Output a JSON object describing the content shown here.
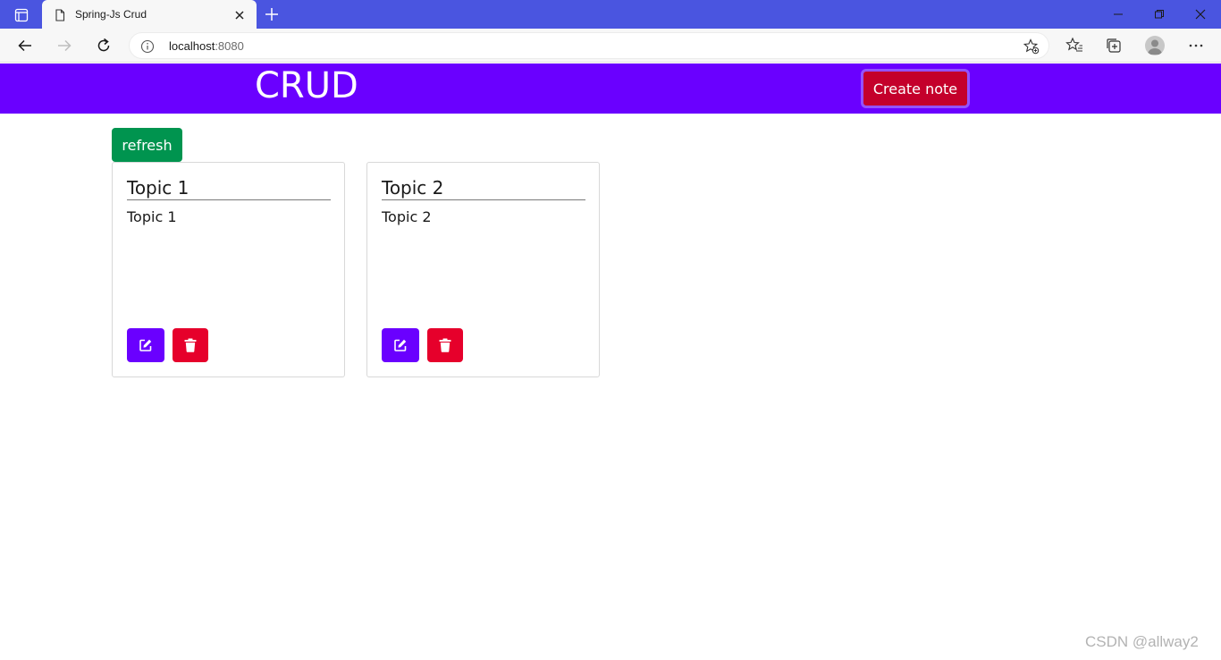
{
  "browser": {
    "tab_title": "Spring-Js Crud",
    "url_host": "localhost",
    "url_port": ":8080"
  },
  "icons": {
    "tab_actions": "tab-actions-icon",
    "favicon": "page-icon",
    "tab_close": "close-icon",
    "new_tab": "plus-icon",
    "minimize": "minimize-icon",
    "restore": "restore-icon",
    "window_close": "close-icon",
    "back": "arrow-left-icon",
    "forward": "arrow-right-icon",
    "reload": "reload-icon",
    "site_info": "info-icon",
    "add_favorite": "star-plus-icon",
    "favorites": "favorites-icon",
    "collections": "collections-icon",
    "profile": "avatar-icon",
    "more": "more-icon",
    "edit": "edit-icon",
    "delete": "trash-icon"
  },
  "colors": {
    "tabbar": "#4a55e0",
    "header": "#6a00ff",
    "create_button": "#c4002b",
    "refresh_button": "#00944f",
    "edit_button": "#6a00ff",
    "delete_button": "#e6002b"
  },
  "header": {
    "title": "CRUD",
    "create_label": "Create note"
  },
  "main": {
    "refresh_label": "refresh",
    "notes": [
      {
        "title": "Topic 1",
        "body": "Topic 1"
      },
      {
        "title": "Topic 2",
        "body": "Topic 2"
      }
    ]
  },
  "watermark": "CSDN @allway2"
}
